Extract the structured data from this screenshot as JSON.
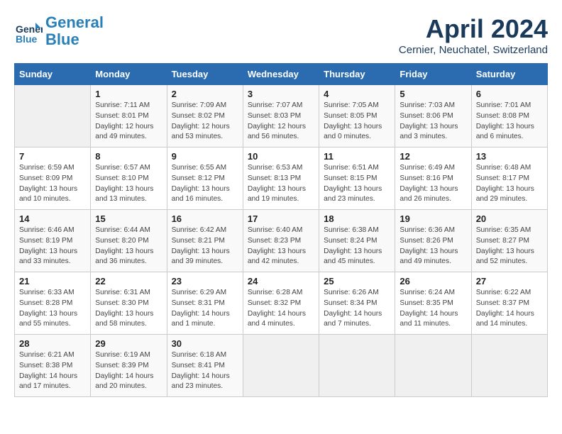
{
  "header": {
    "logo_line1": "General",
    "logo_line2": "Blue",
    "month": "April 2024",
    "location": "Cernier, Neuchatel, Switzerland"
  },
  "weekdays": [
    "Sunday",
    "Monday",
    "Tuesday",
    "Wednesday",
    "Thursday",
    "Friday",
    "Saturday"
  ],
  "weeks": [
    [
      {
        "day": "",
        "info": ""
      },
      {
        "day": "1",
        "info": "Sunrise: 7:11 AM\nSunset: 8:01 PM\nDaylight: 12 hours\nand 49 minutes."
      },
      {
        "day": "2",
        "info": "Sunrise: 7:09 AM\nSunset: 8:02 PM\nDaylight: 12 hours\nand 53 minutes."
      },
      {
        "day": "3",
        "info": "Sunrise: 7:07 AM\nSunset: 8:03 PM\nDaylight: 12 hours\nand 56 minutes."
      },
      {
        "day": "4",
        "info": "Sunrise: 7:05 AM\nSunset: 8:05 PM\nDaylight: 13 hours\nand 0 minutes."
      },
      {
        "day": "5",
        "info": "Sunrise: 7:03 AM\nSunset: 8:06 PM\nDaylight: 13 hours\nand 3 minutes."
      },
      {
        "day": "6",
        "info": "Sunrise: 7:01 AM\nSunset: 8:08 PM\nDaylight: 13 hours\nand 6 minutes."
      }
    ],
    [
      {
        "day": "7",
        "info": "Sunrise: 6:59 AM\nSunset: 8:09 PM\nDaylight: 13 hours\nand 10 minutes."
      },
      {
        "day": "8",
        "info": "Sunrise: 6:57 AM\nSunset: 8:10 PM\nDaylight: 13 hours\nand 13 minutes."
      },
      {
        "day": "9",
        "info": "Sunrise: 6:55 AM\nSunset: 8:12 PM\nDaylight: 13 hours\nand 16 minutes."
      },
      {
        "day": "10",
        "info": "Sunrise: 6:53 AM\nSunset: 8:13 PM\nDaylight: 13 hours\nand 19 minutes."
      },
      {
        "day": "11",
        "info": "Sunrise: 6:51 AM\nSunset: 8:15 PM\nDaylight: 13 hours\nand 23 minutes."
      },
      {
        "day": "12",
        "info": "Sunrise: 6:49 AM\nSunset: 8:16 PM\nDaylight: 13 hours\nand 26 minutes."
      },
      {
        "day": "13",
        "info": "Sunrise: 6:48 AM\nSunset: 8:17 PM\nDaylight: 13 hours\nand 29 minutes."
      }
    ],
    [
      {
        "day": "14",
        "info": "Sunrise: 6:46 AM\nSunset: 8:19 PM\nDaylight: 13 hours\nand 33 minutes."
      },
      {
        "day": "15",
        "info": "Sunrise: 6:44 AM\nSunset: 8:20 PM\nDaylight: 13 hours\nand 36 minutes."
      },
      {
        "day": "16",
        "info": "Sunrise: 6:42 AM\nSunset: 8:21 PM\nDaylight: 13 hours\nand 39 minutes."
      },
      {
        "day": "17",
        "info": "Sunrise: 6:40 AM\nSunset: 8:23 PM\nDaylight: 13 hours\nand 42 minutes."
      },
      {
        "day": "18",
        "info": "Sunrise: 6:38 AM\nSunset: 8:24 PM\nDaylight: 13 hours\nand 45 minutes."
      },
      {
        "day": "19",
        "info": "Sunrise: 6:36 AM\nSunset: 8:26 PM\nDaylight: 13 hours\nand 49 minutes."
      },
      {
        "day": "20",
        "info": "Sunrise: 6:35 AM\nSunset: 8:27 PM\nDaylight: 13 hours\nand 52 minutes."
      }
    ],
    [
      {
        "day": "21",
        "info": "Sunrise: 6:33 AM\nSunset: 8:28 PM\nDaylight: 13 hours\nand 55 minutes."
      },
      {
        "day": "22",
        "info": "Sunrise: 6:31 AM\nSunset: 8:30 PM\nDaylight: 13 hours\nand 58 minutes."
      },
      {
        "day": "23",
        "info": "Sunrise: 6:29 AM\nSunset: 8:31 PM\nDaylight: 14 hours\nand 1 minute."
      },
      {
        "day": "24",
        "info": "Sunrise: 6:28 AM\nSunset: 8:32 PM\nDaylight: 14 hours\nand 4 minutes."
      },
      {
        "day": "25",
        "info": "Sunrise: 6:26 AM\nSunset: 8:34 PM\nDaylight: 14 hours\nand 7 minutes."
      },
      {
        "day": "26",
        "info": "Sunrise: 6:24 AM\nSunset: 8:35 PM\nDaylight: 14 hours\nand 11 minutes."
      },
      {
        "day": "27",
        "info": "Sunrise: 6:22 AM\nSunset: 8:37 PM\nDaylight: 14 hours\nand 14 minutes."
      }
    ],
    [
      {
        "day": "28",
        "info": "Sunrise: 6:21 AM\nSunset: 8:38 PM\nDaylight: 14 hours\nand 17 minutes."
      },
      {
        "day": "29",
        "info": "Sunrise: 6:19 AM\nSunset: 8:39 PM\nDaylight: 14 hours\nand 20 minutes."
      },
      {
        "day": "30",
        "info": "Sunrise: 6:18 AM\nSunset: 8:41 PM\nDaylight: 14 hours\nand 23 minutes."
      },
      {
        "day": "",
        "info": ""
      },
      {
        "day": "",
        "info": ""
      },
      {
        "day": "",
        "info": ""
      },
      {
        "day": "",
        "info": ""
      }
    ]
  ]
}
